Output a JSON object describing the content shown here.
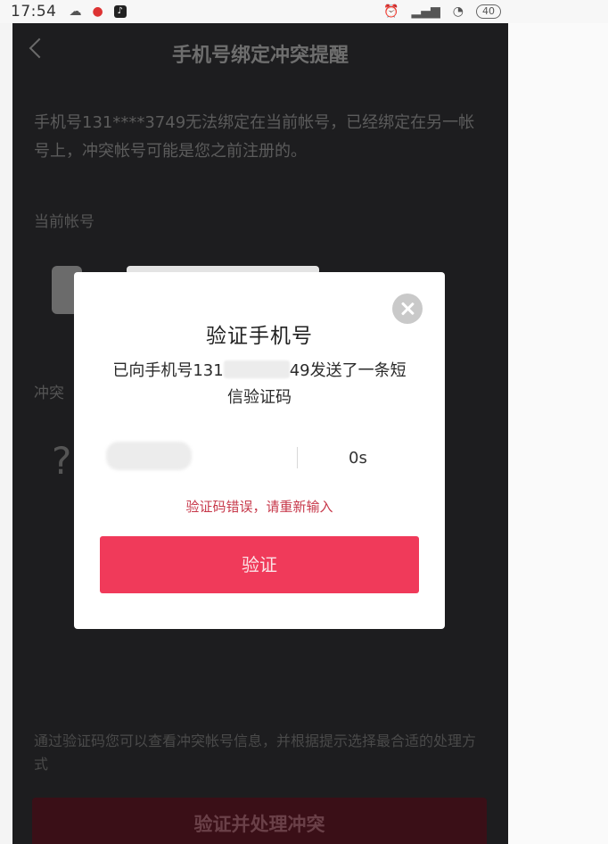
{
  "status_bar": {
    "time": "17:54",
    "battery": "40"
  },
  "page": {
    "title": "手机号绑定冲突提醒",
    "description": "手机号131****3749无法绑定在当前帐号，已经绑定在另一帐号上，冲突帐号可能是您之前注册的。",
    "current_account_label": "当前帐号",
    "conflict_account_label": "冲突",
    "footer_note": "通过验证码您可以查看冲突帐号信息，并根据提示选择最合适的处理方式",
    "bottom_button": "验证并处理冲突",
    "unknown_avatar_glyph": "?"
  },
  "modal": {
    "title": "验证手机号",
    "message_prefix": "已向手机号131",
    "message_suffix": "49发送了一条短",
    "message_line2": "信验证码",
    "countdown": "0s",
    "error": "验证码错误，请重新输入",
    "verify_button": "验证"
  },
  "colors": {
    "accent": "#f03a5a",
    "error": "#c7384a"
  }
}
